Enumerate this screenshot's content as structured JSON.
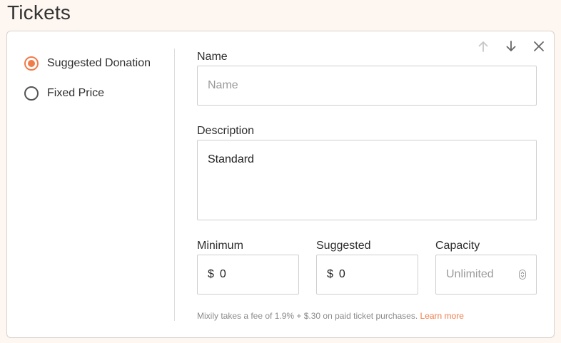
{
  "page": {
    "title": "Tickets"
  },
  "pricing": {
    "options": [
      {
        "label": "Suggested Donation",
        "selected": true
      },
      {
        "label": "Fixed Price",
        "selected": false
      }
    ]
  },
  "controls": {
    "move_up_icon": "arrow-up-icon",
    "move_down_icon": "arrow-down-icon",
    "close_icon": "close-icon"
  },
  "form": {
    "name": {
      "label": "Name",
      "placeholder": "Name",
      "value": ""
    },
    "description": {
      "label": "Description",
      "value": "Standard"
    },
    "minimum": {
      "label": "Minimum",
      "currency": "$",
      "value": "0"
    },
    "suggested": {
      "label": "Suggested",
      "currency": "$",
      "value": "0"
    },
    "capacity": {
      "label": "Capacity",
      "placeholder": "Unlimited"
    }
  },
  "fee": {
    "text": "Mixily takes a fee of 1.9% + $.30 on paid ticket purchases.",
    "link": "Learn more"
  },
  "colors": {
    "accent": "#f07c4a",
    "background": "#fdf6f1"
  }
}
